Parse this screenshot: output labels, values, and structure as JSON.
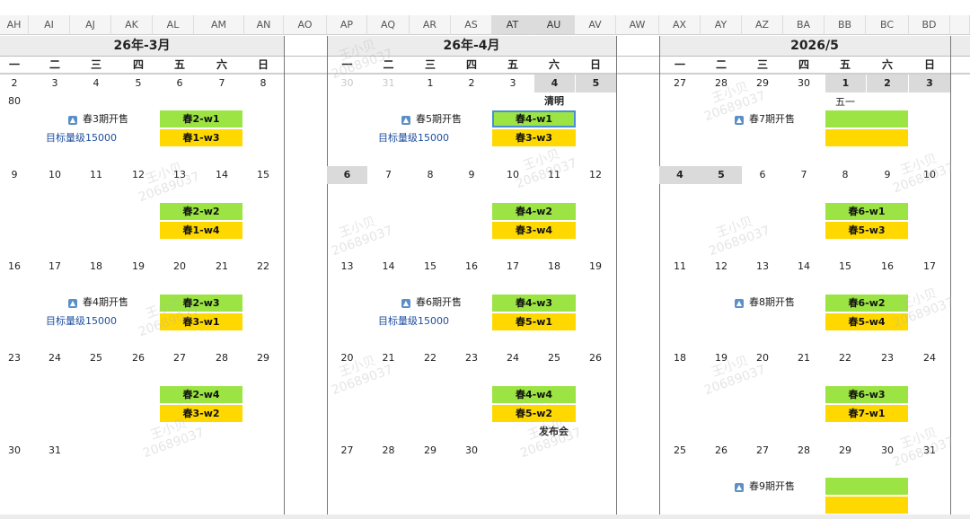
{
  "columns": [
    "AH",
    "AI",
    "AJ",
    "AK",
    "AL",
    "AM",
    "AN",
    "AO",
    "AP",
    "AQ",
    "AR",
    "AS",
    "AT",
    "AU",
    "AV",
    "AW",
    "AX",
    "AY",
    "AZ",
    "BA",
    "BB",
    "BC",
    "BD",
    ""
  ],
  "selected_columns": [
    "AT",
    "AU"
  ],
  "weekdays": [
    "一",
    "二",
    "三",
    "四",
    "五",
    "六",
    "日"
  ],
  "march": {
    "title": "26年-3月",
    "weeks": [
      [
        "2",
        "3",
        "4",
        "5",
        "6",
        "7",
        "8"
      ],
      [
        "9",
        "10",
        "11",
        "12",
        "13",
        "14",
        "15"
      ],
      [
        "16",
        "17",
        "18",
        "19",
        "20",
        "21",
        "22"
      ],
      [
        "23",
        "24",
        "25",
        "26",
        "27",
        "28",
        "29"
      ],
      [
        "30",
        "31",
        "",
        "",
        "",
        "",
        ""
      ]
    ],
    "stray_number": "80",
    "sale_notes": [
      "春3期开售",
      "春4期开售"
    ],
    "targets": [
      "目标量级15000",
      "目标量级15000"
    ],
    "green": [
      "春2-w1",
      "春2-w2",
      "春2-w3",
      "春2-w4"
    ],
    "yellow": [
      "春1-w3",
      "春1-w4",
      "春3-w1",
      "春3-w2"
    ]
  },
  "april": {
    "title": "26年-4月",
    "weeks": [
      [
        "30",
        "31",
        "1",
        "2",
        "3",
        "4",
        "5"
      ],
      [
        "6",
        "7",
        "8",
        "9",
        "10",
        "11",
        "12"
      ],
      [
        "13",
        "14",
        "15",
        "16",
        "17",
        "18",
        "19"
      ],
      [
        "20",
        "21",
        "22",
        "23",
        "24",
        "25",
        "26"
      ],
      [
        "27",
        "28",
        "29",
        "30",
        "",
        "",
        ""
      ]
    ],
    "holiday": "清明",
    "sale_notes": [
      "春5期开售",
      "春6期开售"
    ],
    "targets": [
      "目标量级15000",
      "目标量级15000"
    ],
    "green": [
      "春4-w1",
      "春4-w2",
      "春4-w3",
      "春4-w4"
    ],
    "yellow": [
      "春3-w3",
      "春3-w4",
      "春5-w1",
      "春5-w2"
    ],
    "event": "发布会"
  },
  "may": {
    "title": "2026/5",
    "weeks": [
      [
        "27",
        "28",
        "29",
        "30",
        "1",
        "2",
        "3"
      ],
      [
        "4",
        "5",
        "6",
        "7",
        "8",
        "9",
        "10"
      ],
      [
        "11",
        "12",
        "13",
        "14",
        "15",
        "16",
        "17"
      ],
      [
        "18",
        "19",
        "20",
        "21",
        "22",
        "23",
        "24"
      ],
      [
        "25",
        "26",
        "27",
        "28",
        "29",
        "30",
        "31"
      ]
    ],
    "holiday": "五一",
    "sale_notes": [
      "春7期开售",
      "春8期开售",
      "春9期开售"
    ],
    "green": [
      "",
      "春6-w1",
      "春6-w2",
      "春6-w3",
      ""
    ],
    "yellow": [
      "",
      "春5-w3",
      "春5-w4",
      "春7-w1",
      ""
    ]
  },
  "watermark": {
    "name": "王小贝",
    "id": "20689037"
  }
}
